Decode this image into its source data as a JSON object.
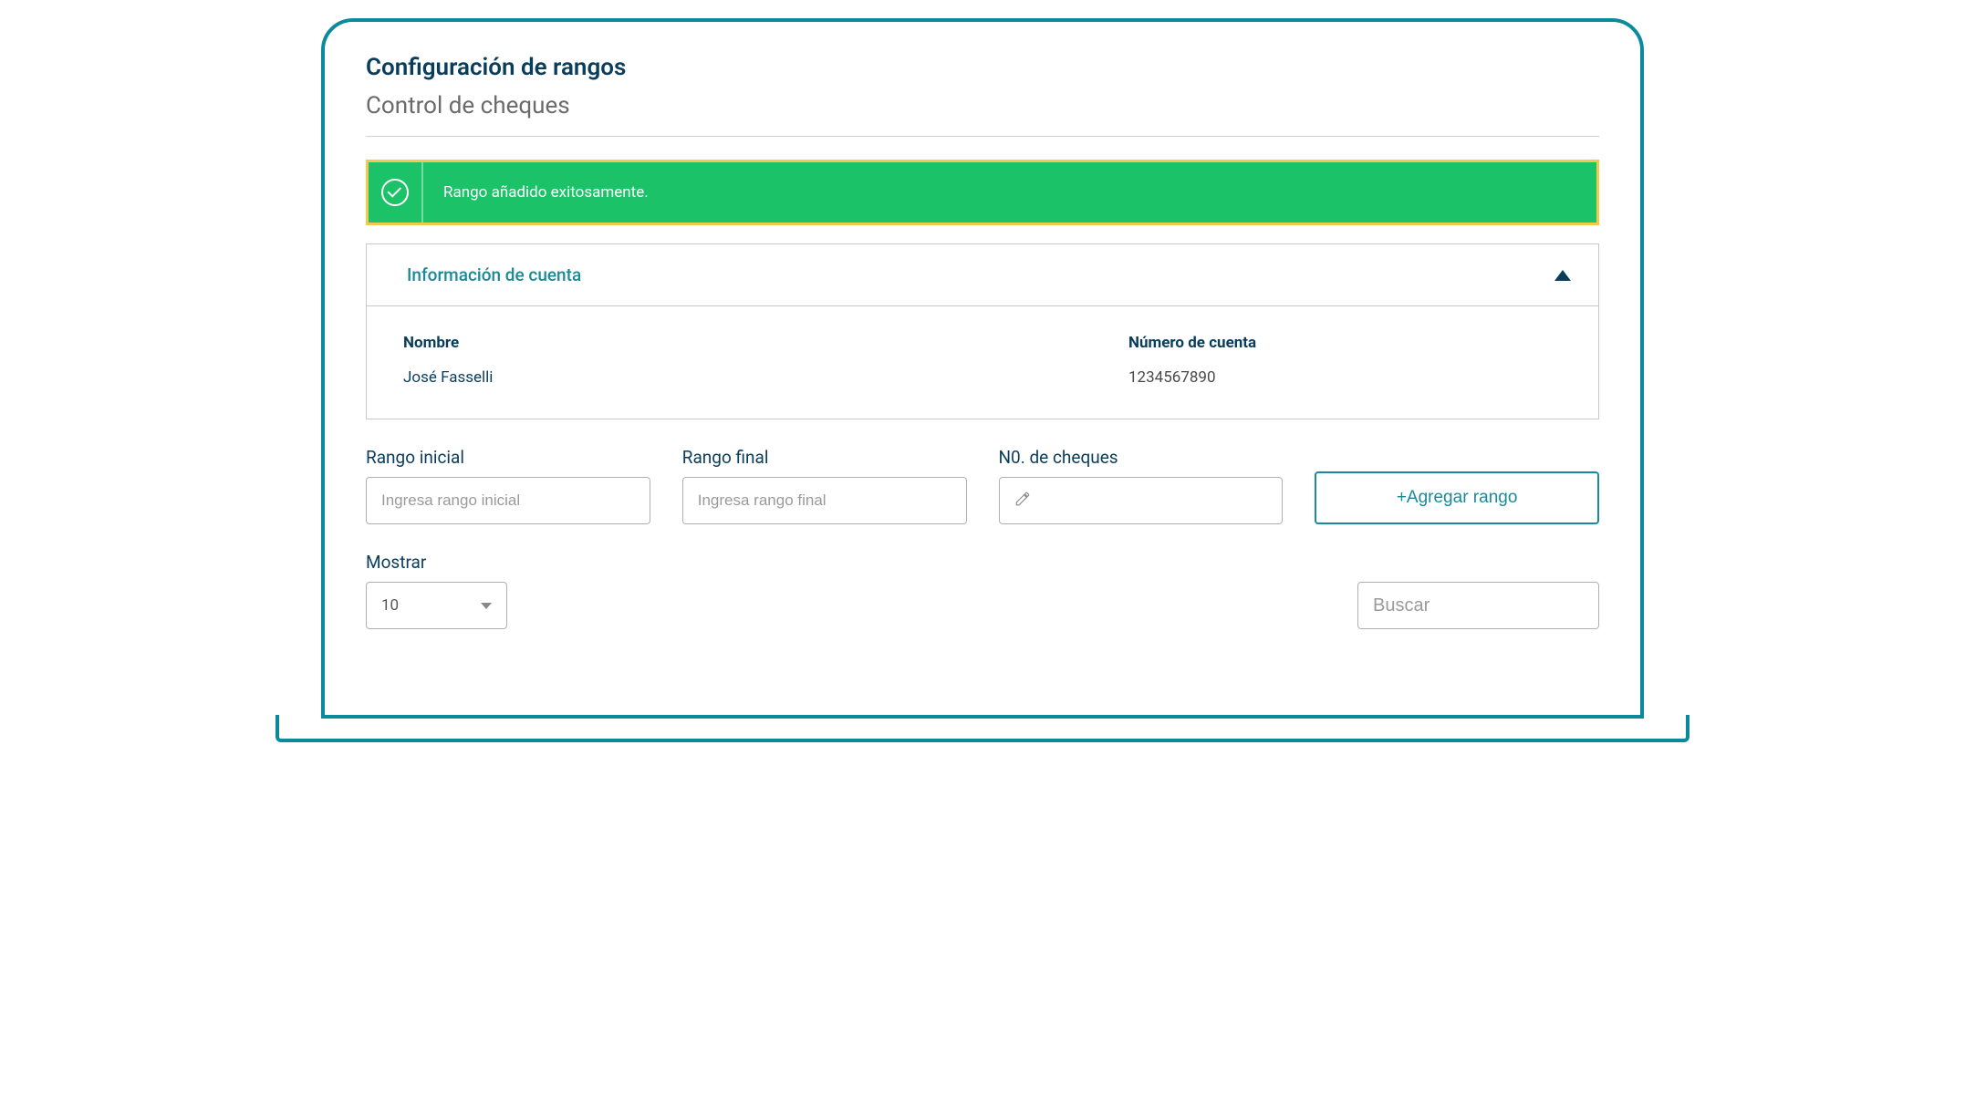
{
  "header": {
    "title": "Configuración de rangos",
    "subtitle": "Control de cheques"
  },
  "alert": {
    "message": "Rango añadido exitosamente."
  },
  "accountInfo": {
    "panelTitle": "Información de cuenta",
    "nameLabel": "Nombre",
    "nameValue": "José Fasselli",
    "accountLabel": "Número de cuenta",
    "accountValue": "1234567890"
  },
  "form": {
    "rangeStartLabel": "Rango inicial",
    "rangeStartPlaceholder": "Ingresa rango inicial",
    "rangeEndLabel": "Rango final",
    "rangeEndPlaceholder": "Ingresa rango final",
    "checksCountLabel": "N0. de cheques",
    "addButtonLabel": "+Agregar rango"
  },
  "filter": {
    "showLabel": "Mostrar",
    "showValue": "10",
    "searchPlaceholder": "Buscar"
  }
}
